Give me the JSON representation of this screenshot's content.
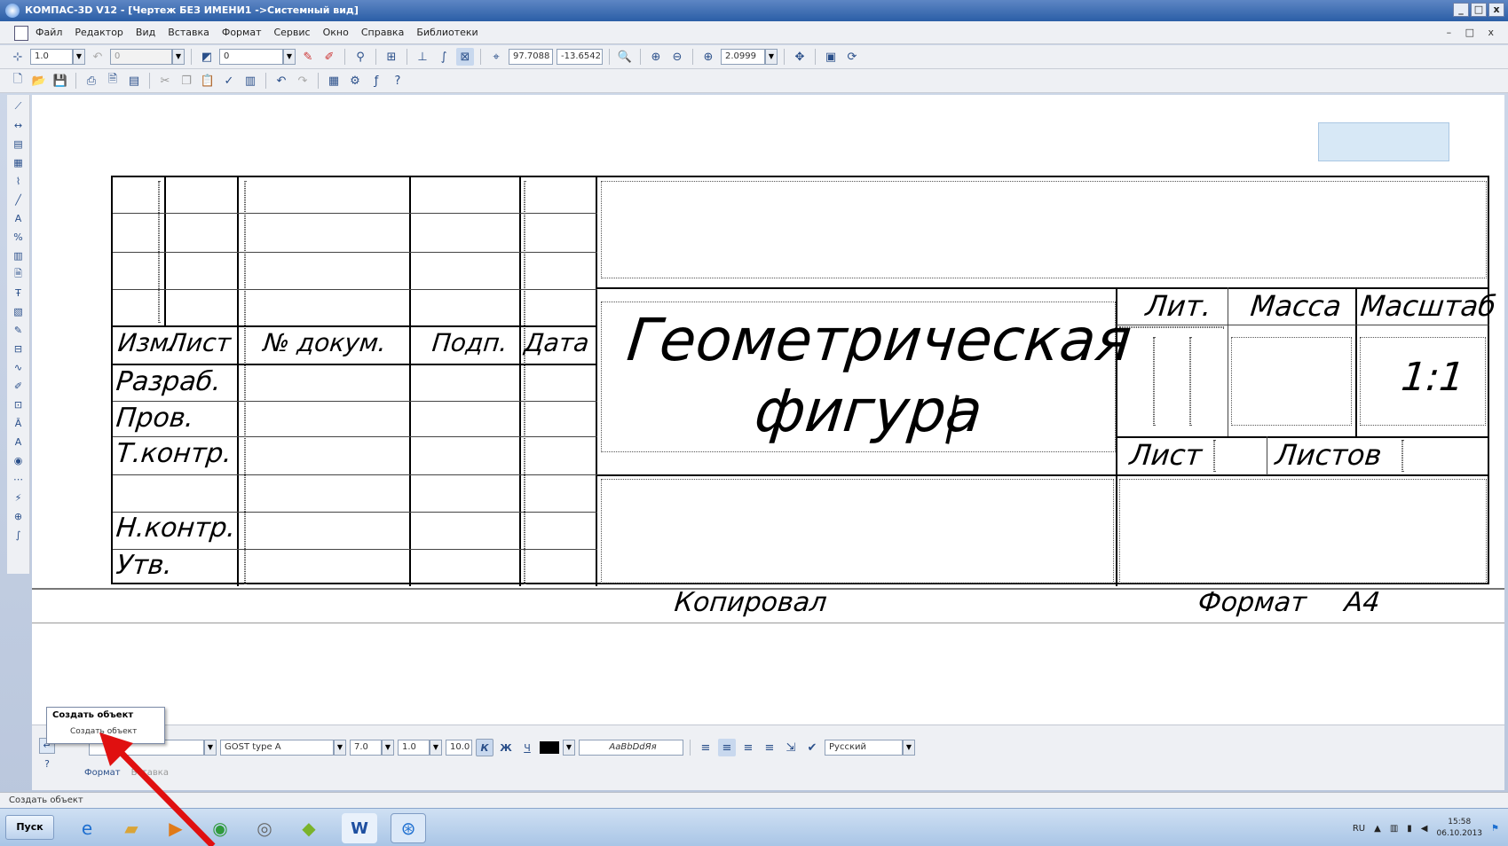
{
  "titlebar": {
    "title": "КОМПАС-3D V12 - [Чертеж БЕЗ ИМЕНИ1 ->Системный вид]",
    "min": "_",
    "max": "□",
    "close": "x"
  },
  "menu": [
    "Файл",
    "Редактор",
    "Вид",
    "Вставка",
    "Формат",
    "Сервис",
    "Окно",
    "Справка",
    "Библиотеки"
  ],
  "mdi_ctrls": "– □ x",
  "toolbar1": {
    "scale": "1.0",
    "layer_gray": "0",
    "layer": "0",
    "coord_x": "97.7088",
    "coord_y": "-13.6542",
    "zoom": "2.0999"
  },
  "stamp": {
    "header_cells": [
      "Изм.",
      "Лист",
      "№ докум.",
      "Подп.",
      "Дата"
    ],
    "rows": [
      "Разраб.",
      "Пров.",
      "Т.контр.",
      "",
      "Н.контр.",
      "Утв."
    ],
    "title_line1": "Геометрическая",
    "title_line2": "фигура",
    "lit": "Лит.",
    "mass": "Масса",
    "scale_label": "Масштаб",
    "scale_value": "1:1",
    "sheet": "Лист",
    "sheets": "Листов"
  },
  "footer": {
    "copied": "Копировал",
    "format_label": "Формат",
    "format_value": "A4"
  },
  "tooltip": {
    "title": "Создать объект",
    "subtitle": "Создать объект"
  },
  "props": {
    "font": "GOST type A",
    "height": "7.0",
    "ratio": "1.0",
    "step": "10.0",
    "bold": "К",
    "italic": "Ж",
    "underline": "Ч",
    "sample": "АаBbDdЯя",
    "language": "Русский"
  },
  "prop_tabs": [
    "Формат",
    "Вставка"
  ],
  "status": "Создать объект",
  "taskbar": {
    "start": "Пуск",
    "lang": "RU",
    "time": "15:58",
    "date": "06.10.2013"
  },
  "colors": {
    "accent": "#2b5ea6",
    "arrow": "#e01010"
  }
}
